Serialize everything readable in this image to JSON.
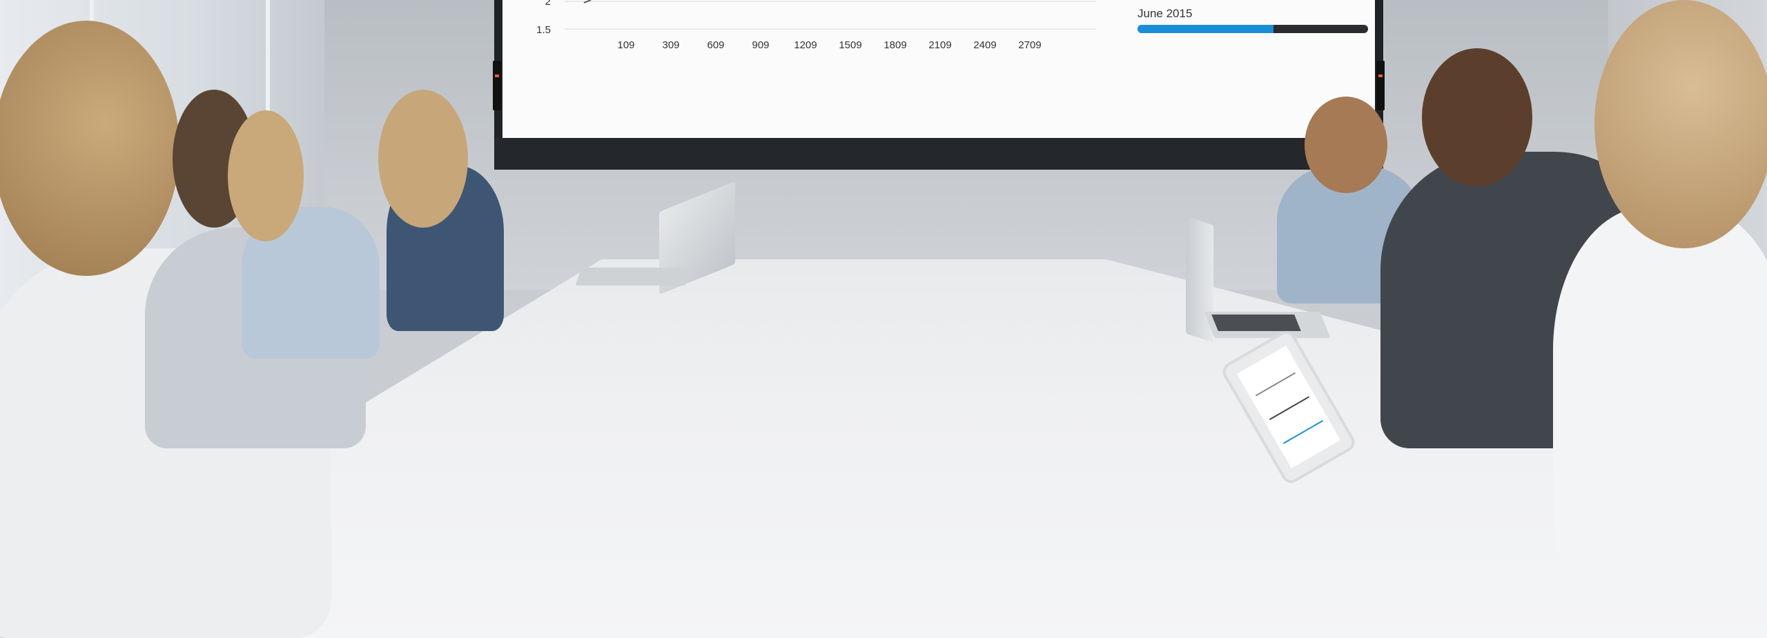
{
  "scene": {
    "description_kind": "photo",
    "display": {
      "chart": {
        "y_ticks": [
          "2",
          "1.5"
        ],
        "x_ticks": [
          "109",
          "309",
          "609",
          "909",
          "1209",
          "1509",
          "1809",
          "2109",
          "2409",
          "2709"
        ]
      },
      "legend": {
        "label": "June 2015",
        "progress_fraction": 0.59,
        "progress_color": "#1a8fd8"
      }
    },
    "colors": {
      "bezel": "#1f2226",
      "accent_button": "#e3622c"
    }
  }
}
